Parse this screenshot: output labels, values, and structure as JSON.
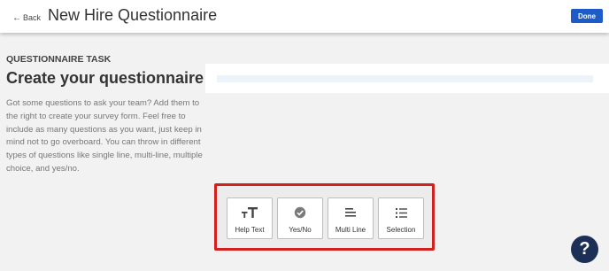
{
  "header": {
    "back_arrow": "←",
    "back_label": "Back",
    "title": "New Hire Questionnaire",
    "done_label": "Done"
  },
  "main": {
    "section_label": "QUESTIONNAIRE TASK",
    "heading": "Create your questionnaire",
    "description": "Got some questions to ask your team? Add them to the right to create your survey form. Feel free to include as many questions as you want, just keep in mind not to go overboard. You can throw in different types of questions like single line, multi-line, multiple choice, and yes/no."
  },
  "question_types": [
    {
      "label": "Help Text",
      "icon": "text-format-icon"
    },
    {
      "label": "Yes/No",
      "icon": "check-circle-icon"
    },
    {
      "label": "Multi Line",
      "icon": "multi-line-icon"
    },
    {
      "label": "Selection",
      "icon": "list-icon"
    }
  ],
  "help": {
    "label": "?"
  },
  "colors": {
    "accent": "#1e5bc6",
    "highlight_border": "#d41f1f",
    "help_button": "#1c2f57",
    "background": "#f2f2f2"
  }
}
